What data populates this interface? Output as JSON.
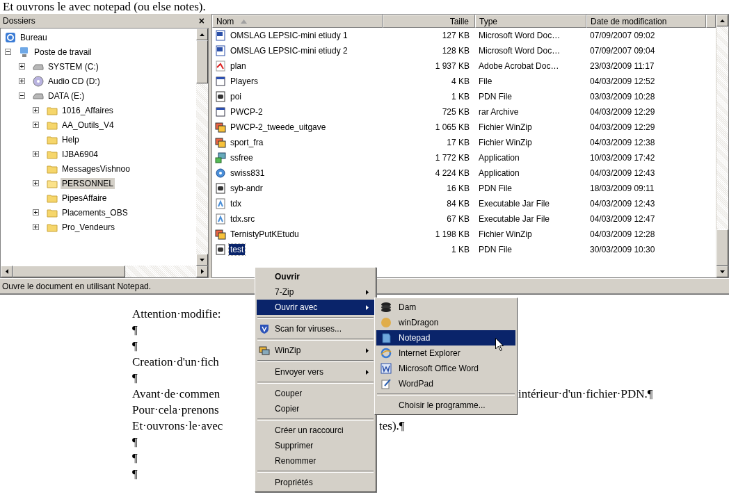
{
  "document": {
    "top_line": "Et ouvrons le avec notepad (ou else notes).",
    "lines": [
      {
        "segments": [
          {
            "kind": "left",
            "text": "Attention·modifie:"
          }
        ]
      },
      {
        "segments": [
          {
            "kind": "left",
            "text": "¶"
          }
        ]
      },
      {
        "segments": [
          {
            "kind": "left",
            "text": "¶"
          }
        ]
      },
      {
        "segments": [
          {
            "kind": "left",
            "text": "Creation·d'un·fich"
          }
        ]
      },
      {
        "segments": [
          {
            "kind": "left",
            "text": "¶"
          }
        ]
      },
      {
        "segments": [
          {
            "kind": "left",
            "text": "Avant·de·commen"
          },
          {
            "kind": "after_submenu",
            "text": "intérieur·d'un·fichier·PDN.¶"
          }
        ]
      },
      {
        "segments": [
          {
            "kind": "left",
            "text": "Pour·cela·prenons"
          }
        ]
      },
      {
        "segments": [
          {
            "kind": "left",
            "text": "Et·ouvrons·le·avec"
          },
          {
            "kind": "after_menu",
            "text": "tes).¶"
          }
        ]
      },
      {
        "segments": [
          {
            "kind": "left",
            "text": "¶"
          }
        ]
      },
      {
        "segments": [
          {
            "kind": "left",
            "text": "¶"
          }
        ]
      },
      {
        "segments": [
          {
            "kind": "left",
            "text": "¶"
          }
        ]
      }
    ]
  },
  "folders": {
    "title": "Dossiers",
    "close": "×",
    "items": [
      {
        "label": "Bureau",
        "kind": "desktop",
        "selected": false,
        "children": [
          {
            "label": "Poste de travail",
            "kind": "computer",
            "expanded": true,
            "selected": false,
            "children": [
              {
                "label": "SYSTEM (C:)",
                "kind": "drive",
                "expanded": false,
                "selected": false
              },
              {
                "label": "Audio CD (D:)",
                "kind": "cd",
                "expanded": false,
                "selected": false
              },
              {
                "label": "DATA (E:)",
                "kind": "drive",
                "expanded": true,
                "selected": false,
                "children": [
                  {
                    "label": "1016_Affaires",
                    "kind": "folder",
                    "expanded": false,
                    "selected": false
                  },
                  {
                    "label": "AA_Outils_V4",
                    "kind": "folder",
                    "expanded": false,
                    "selected": false
                  },
                  {
                    "label": "Help",
                    "kind": "folder",
                    "selected": false
                  },
                  {
                    "label": "IJBA6904",
                    "kind": "folder",
                    "expanded": false,
                    "selected": false
                  },
                  {
                    "label": "MessagesVishnoo",
                    "kind": "folder",
                    "selected": false
                  },
                  {
                    "label": "PERSONNEL",
                    "kind": "folder",
                    "expanded": false,
                    "selected": true
                  },
                  {
                    "label": "PipesAffaire",
                    "kind": "folder",
                    "selected": false
                  },
                  {
                    "label": "Placements_OBS",
                    "kind": "folder",
                    "expanded": false,
                    "selected": false
                  },
                  {
                    "label": "Pro_Vendeurs",
                    "kind": "folder",
                    "expanded": false,
                    "selected": false
                  }
                ]
              }
            ]
          }
        ]
      }
    ]
  },
  "files": {
    "columns": [
      {
        "label": "Nom",
        "sorted": true
      },
      {
        "label": "Taille",
        "sorted": false
      },
      {
        "label": "Type",
        "sorted": false
      },
      {
        "label": "Date de modification",
        "sorted": false
      }
    ],
    "rows": [
      {
        "name": "OMSLAG  LEPSIC-mini etiudy 1",
        "size": "127 KB",
        "type": "Microsoft Word Doc…",
        "date": "07/09/2007 09:02",
        "kind": "word",
        "selected": false
      },
      {
        "name": "OMSLAG  LEPSIC-mini etiudy 2",
        "size": "128 KB",
        "type": "Microsoft Word Doc…",
        "date": "07/09/2007 09:04",
        "kind": "word",
        "selected": false
      },
      {
        "name": "plan",
        "size": "1 937 KB",
        "type": "Adobe Acrobat Doc…",
        "date": "23/03/2009 11:17",
        "kind": "pdf",
        "selected": false
      },
      {
        "name": "Players",
        "size": "4 KB",
        "type": "File",
        "date": "04/03/2009 12:52",
        "kind": "window",
        "selected": false
      },
      {
        "name": "poi",
        "size": "1 KB",
        "type": "PDN File",
        "date": "03/03/2009 10:28",
        "kind": "pdn",
        "selected": false
      },
      {
        "name": "PWCP-2",
        "size": "725 KB",
        "type": "rar Archive",
        "date": "04/03/2009 12:29",
        "kind": "window",
        "selected": false
      },
      {
        "name": "PWCP-2_tweede_uitgave",
        "size": "1 065 KB",
        "type": "Fichier WinZip",
        "date": "04/03/2009 12:29",
        "kind": "zip",
        "selected": false
      },
      {
        "name": "sport_fra",
        "size": "17 KB",
        "type": "Fichier WinZip",
        "date": "04/03/2009 12:38",
        "kind": "zip",
        "selected": false
      },
      {
        "name": "ssfree",
        "size": "1 772 KB",
        "type": "Application",
        "date": "10/03/2009 17:42",
        "kind": "setup",
        "selected": false
      },
      {
        "name": "swiss831",
        "size": "4 224 KB",
        "type": "Application",
        "date": "04/03/2009 12:43",
        "kind": "app",
        "selected": false
      },
      {
        "name": "syb-andr",
        "size": "16 KB",
        "type": "PDN File",
        "date": "18/03/2009 09:11",
        "kind": "pdn",
        "selected": false
      },
      {
        "name": "tdx",
        "size": "84 KB",
        "type": "Executable Jar File",
        "date": "04/03/2009 12:43",
        "kind": "jar",
        "selected": false
      },
      {
        "name": "tdx.src",
        "size": "67 KB",
        "type": "Executable Jar File",
        "date": "04/03/2009 12:47",
        "kind": "jar",
        "selected": false
      },
      {
        "name": "TernistyPutKEtudu",
        "size": "1 198 KB",
        "type": "Fichier WinZip",
        "date": "04/03/2009 12:28",
        "kind": "zip",
        "selected": false
      },
      {
        "name": "test",
        "size": "1 KB",
        "type": "PDN File",
        "date": "30/03/2009 10:30",
        "kind": "pdn",
        "selected": true
      }
    ]
  },
  "status_bar": {
    "text": "Ouvre le document en utilisant Notepad."
  },
  "context_menu": {
    "items": [
      {
        "kind": "plain",
        "label": "Ouvrir",
        "default": true,
        "submenu": false,
        "selected": false
      },
      {
        "kind": "plain",
        "label": "7-Zip",
        "default": false,
        "submenu": true,
        "selected": false
      },
      {
        "kind": "plain",
        "label": "Ouvrir avec",
        "default": false,
        "submenu": true,
        "selected": true
      },
      {
        "kind": "separator"
      },
      {
        "kind": "shield",
        "label": "Scan for viruses...",
        "default": false,
        "submenu": false,
        "selected": false
      },
      {
        "kind": "separator"
      },
      {
        "kind": "winzip",
        "label": "WinZip",
        "default": false,
        "submenu": true,
        "selected": false
      },
      {
        "kind": "separator"
      },
      {
        "kind": "plain",
        "label": "Envoyer vers",
        "default": false,
        "submenu": true,
        "selected": false
      },
      {
        "kind": "separator"
      },
      {
        "kind": "plain",
        "label": "Couper",
        "default": false,
        "submenu": false,
        "selected": false
      },
      {
        "kind": "plain",
        "label": "Copier",
        "default": false,
        "submenu": false,
        "selected": false
      },
      {
        "kind": "separator"
      },
      {
        "kind": "plain",
        "label": "Créer un raccourci",
        "default": false,
        "submenu": false,
        "selected": false
      },
      {
        "kind": "plain",
        "label": "Supprimer",
        "default": false,
        "submenu": false,
        "selected": false
      },
      {
        "kind": "plain",
        "label": "Renommer",
        "default": false,
        "submenu": false,
        "selected": false
      },
      {
        "kind": "separator"
      },
      {
        "kind": "plain",
        "label": "Propriétés",
        "default": false,
        "submenu": false,
        "selected": false
      }
    ]
  },
  "open_with_menu": {
    "items": [
      {
        "kind": "disks",
        "label": "Dam",
        "selected": false
      },
      {
        "kind": "orb",
        "label": "winDragon",
        "selected": false
      },
      {
        "kind": "notepad",
        "label": "Notepad",
        "selected": true
      },
      {
        "kind": "globe",
        "label": "Internet Explorer",
        "selected": false
      },
      {
        "kind": "word",
        "label": "Microsoft Office Word",
        "selected": false
      },
      {
        "kind": "pen",
        "label": "WordPad",
        "selected": false
      },
      {
        "kind": "separator"
      },
      {
        "kind": "plain",
        "label": "Choisir le programme...",
        "selected": false
      }
    ]
  }
}
